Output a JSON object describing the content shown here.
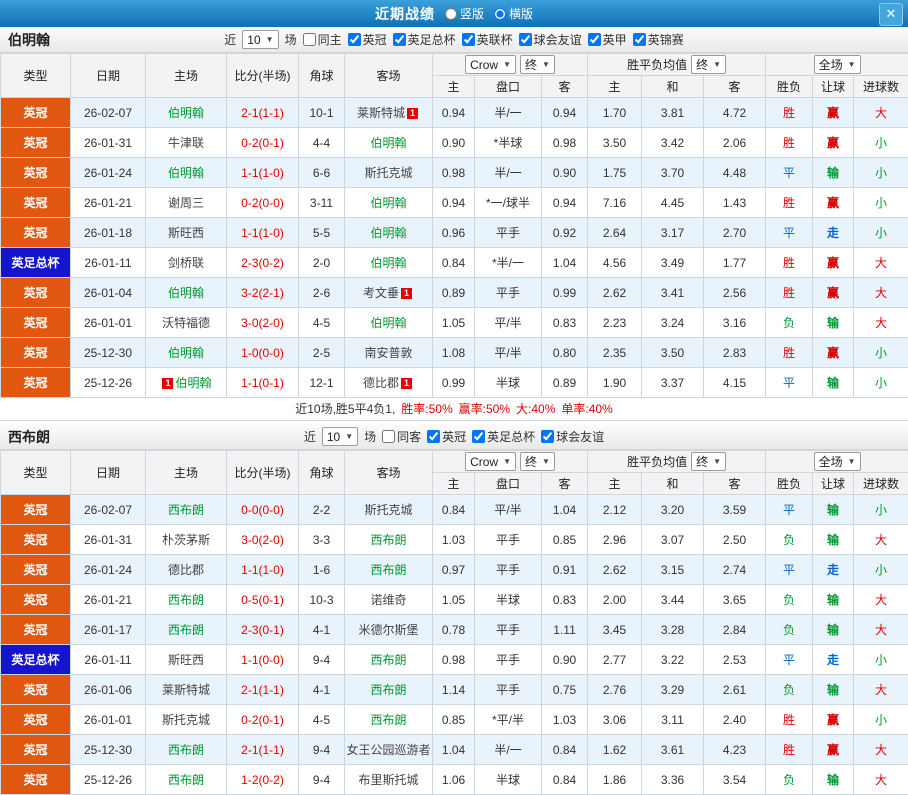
{
  "title_bar": {
    "title": "近期战绩",
    "layout_options": [
      {
        "label": "竖版",
        "selected": false
      },
      {
        "label": "横版",
        "selected": true
      }
    ]
  },
  "icons": {
    "caret": "▼",
    "close": "✕"
  },
  "filter_labels": {
    "near": "近",
    "games": "场"
  },
  "table_headers": {
    "type": "类型",
    "date": "日期",
    "home": "主场",
    "score": "比分(半场)",
    "corner": "角球",
    "away": "客场",
    "odds_source": "Crow",
    "odds_final": "终",
    "avg_title": "胜平负均值",
    "avg_final": "终",
    "fullmatch": "全场",
    "sub": {
      "home": "主",
      "handicap": "盘口",
      "away": "客",
      "avg_home": "主",
      "avg_draw": "和",
      "avg_away": "客",
      "result": "胜负",
      "let": "让球",
      "goals": "进球数"
    }
  },
  "colors": {
    "league_bg": "#e2570f",
    "cup_bg": "#1414cf",
    "team_highlight": "#009933",
    "team_default": "#444444",
    "score": "#e60000",
    "win": "#e60000",
    "draw": "#0066cc",
    "lose": "#009933",
    "let_win": "#d40000",
    "let_lose": "#009933",
    "let_push": "#0066cc",
    "big": "#e60000",
    "small": "#009933",
    "badge": "#e60000"
  },
  "sections": [
    {
      "team": "伯明翰",
      "games_count": "10",
      "checkboxes": [
        {
          "label": "同主",
          "checked": false
        },
        {
          "label": "英冠",
          "checked": true
        },
        {
          "label": "英足总杯",
          "checked": true
        },
        {
          "label": "英联杯",
          "checked": true
        },
        {
          "label": "球会友谊",
          "checked": true
        },
        {
          "label": "英甲",
          "checked": true
        },
        {
          "label": "英锦赛",
          "checked": true
        }
      ],
      "rows": [
        {
          "type": "英冠",
          "cup": false,
          "date": "26-02-07",
          "home": "伯明翰",
          "home_hl": true,
          "score": "2-1(1-1)",
          "corner": "10-1",
          "away": "莱斯特城",
          "away_hl": false,
          "away_badge": "1",
          "o1": "0.94",
          "hc": "半/一",
          "o2": "0.94",
          "a1": "1.70",
          "a2": "3.81",
          "a3": "4.72",
          "res": "胜",
          "let": "赢",
          "goal": "大"
        },
        {
          "type": "英冠",
          "cup": false,
          "date": "26-01-31",
          "home": "牛津联",
          "home_hl": false,
          "score": "0-2(0-1)",
          "corner": "4-4",
          "away": "伯明翰",
          "away_hl": true,
          "o1": "0.90",
          "hc": "*半球",
          "o2": "0.98",
          "a1": "3.50",
          "a2": "3.42",
          "a3": "2.06",
          "res": "胜",
          "let": "赢",
          "goal": "小"
        },
        {
          "type": "英冠",
          "cup": false,
          "date": "26-01-24",
          "home": "伯明翰",
          "home_hl": true,
          "score": "1-1(1-0)",
          "corner": "6-6",
          "away": "斯托克城",
          "away_hl": false,
          "o1": "0.98",
          "hc": "半/一",
          "o2": "0.90",
          "a1": "1.75",
          "a2": "3.70",
          "a3": "4.48",
          "res": "平",
          "let": "输",
          "goal": "小"
        },
        {
          "type": "英冠",
          "cup": false,
          "date": "26-01-21",
          "home": "谢周三",
          "home_hl": false,
          "score": "0-2(0-0)",
          "corner": "3-11",
          "away": "伯明翰",
          "away_hl": true,
          "o1": "0.94",
          "hc": "*一/球半",
          "o2": "0.94",
          "a1": "7.16",
          "a2": "4.45",
          "a3": "1.43",
          "res": "胜",
          "let": "赢",
          "goal": "小"
        },
        {
          "type": "英冠",
          "cup": false,
          "date": "26-01-18",
          "home": "斯旺西",
          "home_hl": false,
          "score": "1-1(1-0)",
          "corner": "5-5",
          "away": "伯明翰",
          "away_hl": true,
          "o1": "0.96",
          "hc": "平手",
          "o2": "0.92",
          "a1": "2.64",
          "a2": "3.17",
          "a3": "2.70",
          "res": "平",
          "let": "走",
          "goal": "小"
        },
        {
          "type": "英足总杯",
          "cup": true,
          "date": "26-01-11",
          "home": "剑桥联",
          "home_hl": false,
          "score": "2-3(0-2)",
          "corner": "2-0",
          "away": "伯明翰",
          "away_hl": true,
          "o1": "0.84",
          "hc": "*半/一",
          "o2": "1.04",
          "a1": "4.56",
          "a2": "3.49",
          "a3": "1.77",
          "res": "胜",
          "let": "赢",
          "goal": "大"
        },
        {
          "type": "英冠",
          "cup": false,
          "date": "26-01-04",
          "home": "伯明翰",
          "home_hl": true,
          "score": "3-2(2-1)",
          "corner": "2-6",
          "away": "考文垂",
          "away_hl": false,
          "away_badge": "1",
          "o1": "0.89",
          "hc": "平手",
          "o2": "0.99",
          "a1": "2.62",
          "a2": "3.41",
          "a3": "2.56",
          "res": "胜",
          "let": "赢",
          "goal": "大"
        },
        {
          "type": "英冠",
          "cup": false,
          "date": "26-01-01",
          "home": "沃特福德",
          "home_hl": false,
          "score": "3-0(2-0)",
          "corner": "4-5",
          "away": "伯明翰",
          "away_hl": true,
          "o1": "1.05",
          "hc": "平/半",
          "o2": "0.83",
          "a1": "2.23",
          "a2": "3.24",
          "a3": "3.16",
          "res": "负",
          "let": "输",
          "goal": "大"
        },
        {
          "type": "英冠",
          "cup": false,
          "date": "25-12-30",
          "home": "伯明翰",
          "home_hl": true,
          "score": "1-0(0-0)",
          "corner": "2-5",
          "away": "南安普敦",
          "away_hl": false,
          "o1": "1.08",
          "hc": "平/半",
          "o2": "0.80",
          "a1": "2.35",
          "a2": "3.50",
          "a3": "2.83",
          "res": "胜",
          "let": "赢",
          "goal": "小"
        },
        {
          "type": "英冠",
          "cup": false,
          "date": "25-12-26",
          "home": "伯明翰",
          "home_hl": true,
          "home_badge_pre": "1",
          "score": "1-1(0-1)",
          "corner": "12-1",
          "away": "德比郡",
          "away_hl": false,
          "away_badge": "1",
          "o1": "0.99",
          "hc": "半球",
          "o2": "0.89",
          "a1": "1.90",
          "a2": "3.37",
          "a3": "4.15",
          "res": "平",
          "let": "输",
          "goal": "小"
        }
      ],
      "summary": [
        {
          "text": "近10场,胜5平4负1,",
          "color": "#333333"
        },
        {
          "text": "胜率:50%",
          "color": "#e60000"
        },
        {
          "text": "赢率:50%",
          "color": "#e60000"
        },
        {
          "text": "大:40%",
          "color": "#e60000"
        },
        {
          "text": "单率:40%",
          "color": "#e60000"
        }
      ]
    },
    {
      "team": "西布朗",
      "games_count": "10",
      "checkboxes": [
        {
          "label": "同客",
          "checked": false
        },
        {
          "label": "英冠",
          "checked": true
        },
        {
          "label": "英足总杯",
          "checked": true
        },
        {
          "label": "球会友谊",
          "checked": true
        }
      ],
      "rows": [
        {
          "type": "英冠",
          "cup": false,
          "date": "26-02-07",
          "home": "西布朗",
          "home_hl": true,
          "score": "0-0(0-0)",
          "corner": "2-2",
          "away": "斯托克城",
          "away_hl": false,
          "o1": "0.84",
          "hc": "平/半",
          "o2": "1.04",
          "a1": "2.12",
          "a2": "3.20",
          "a3": "3.59",
          "res": "平",
          "let": "输",
          "goal": "小"
        },
        {
          "type": "英冠",
          "cup": false,
          "date": "26-01-31",
          "home": "朴茨茅斯",
          "home_hl": false,
          "score": "3-0(2-0)",
          "corner": "3-3",
          "away": "西布朗",
          "away_hl": true,
          "o1": "1.03",
          "hc": "平手",
          "o2": "0.85",
          "a1": "2.96",
          "a2": "3.07",
          "a3": "2.50",
          "res": "负",
          "let": "输",
          "goal": "大"
        },
        {
          "type": "英冠",
          "cup": false,
          "date": "26-01-24",
          "home": "德比郡",
          "home_hl": false,
          "score": "1-1(1-0)",
          "corner": "1-6",
          "away": "西布朗",
          "away_hl": true,
          "o1": "0.97",
          "hc": "平手",
          "o2": "0.91",
          "a1": "2.62",
          "a2": "3.15",
          "a3": "2.74",
          "res": "平",
          "let": "走",
          "goal": "小"
        },
        {
          "type": "英冠",
          "cup": false,
          "date": "26-01-21",
          "home": "西布朗",
          "home_hl": true,
          "score": "0-5(0-1)",
          "corner": "10-3",
          "away": "诺维奇",
          "away_hl": false,
          "o1": "1.05",
          "hc": "半球",
          "o2": "0.83",
          "a1": "2.00",
          "a2": "3.44",
          "a3": "3.65",
          "res": "负",
          "let": "输",
          "goal": "大"
        },
        {
          "type": "英冠",
          "cup": false,
          "date": "26-01-17",
          "home": "西布朗",
          "home_hl": true,
          "score": "2-3(0-1)",
          "corner": "4-1",
          "away": "米德尔斯堡",
          "away_hl": false,
          "o1": "0.78",
          "hc": "平手",
          "o2": "1.11",
          "a1": "3.45",
          "a2": "3.28",
          "a3": "2.84",
          "res": "负",
          "let": "输",
          "goal": "大"
        },
        {
          "type": "英足总杯",
          "cup": true,
          "date": "26-01-11",
          "home": "斯旺西",
          "home_hl": false,
          "score": "1-1(0-0)",
          "corner": "9-4",
          "away": "西布朗",
          "away_hl": true,
          "o1": "0.98",
          "hc": "平手",
          "o2": "0.90",
          "a1": "2.77",
          "a2": "3.22",
          "a3": "2.53",
          "res": "平",
          "let": "走",
          "goal": "小"
        },
        {
          "type": "英冠",
          "cup": false,
          "date": "26-01-06",
          "home": "莱斯特城",
          "home_hl": false,
          "score": "2-1(1-1)",
          "corner": "4-1",
          "away": "西布朗",
          "away_hl": true,
          "o1": "1.14",
          "hc": "平手",
          "o2": "0.75",
          "a1": "2.76",
          "a2": "3.29",
          "a3": "2.61",
          "res": "负",
          "let": "输",
          "goal": "大"
        },
        {
          "type": "英冠",
          "cup": false,
          "date": "26-01-01",
          "home": "斯托克城",
          "home_hl": false,
          "score": "0-2(0-1)",
          "corner": "4-5",
          "away": "西布朗",
          "away_hl": true,
          "o1": "0.85",
          "hc": "*平/半",
          "o2": "1.03",
          "a1": "3.06",
          "a2": "3.11",
          "a3": "2.40",
          "res": "胜",
          "let": "赢",
          "goal": "小"
        },
        {
          "type": "英冠",
          "cup": false,
          "date": "25-12-30",
          "home": "西布朗",
          "home_hl": true,
          "score": "2-1(1-1)",
          "corner": "9-4",
          "away": "女王公园巡游者",
          "away_hl": false,
          "o1": "1.04",
          "hc": "半/一",
          "o2": "0.84",
          "a1": "1.62",
          "a2": "3.61",
          "a3": "4.23",
          "res": "胜",
          "let": "赢",
          "goal": "大"
        },
        {
          "type": "英冠",
          "cup": false,
          "date": "25-12-26",
          "home": "西布朗",
          "home_hl": true,
          "score": "1-2(0-2)",
          "corner": "9-4",
          "away": "布里斯托城",
          "away_hl": false,
          "o1": "1.06",
          "hc": "半球",
          "o2": "0.84",
          "a1": "1.86",
          "a2": "3.36",
          "a3": "3.54",
          "res": "负",
          "let": "输",
          "goal": "大"
        }
      ],
      "summary": []
    }
  ]
}
